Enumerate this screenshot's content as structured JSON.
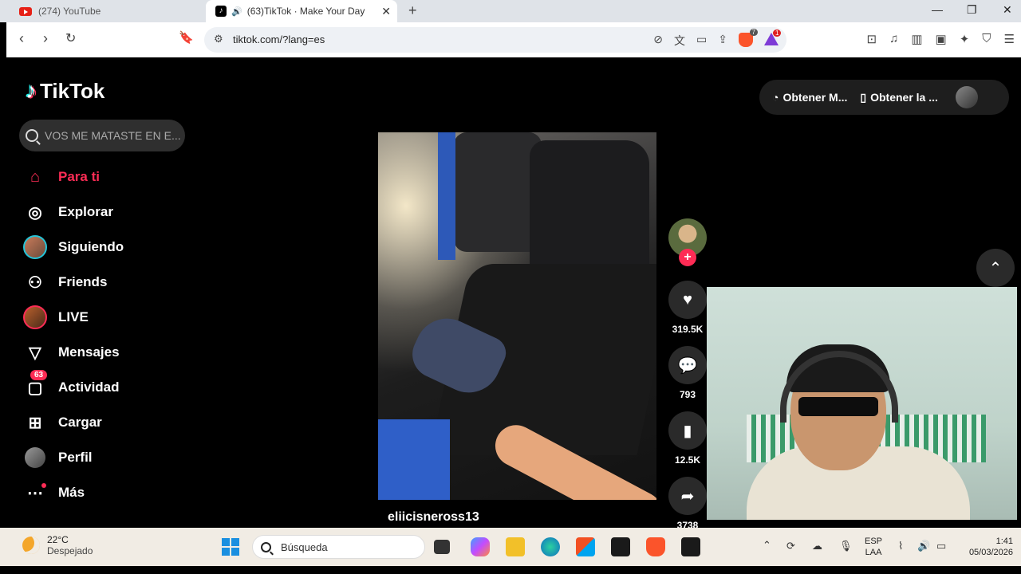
{
  "browser": {
    "tabs": [
      {
        "title": "(274) YouTube"
      },
      {
        "title": "(63)TikTok · Make Your Day"
      }
    ],
    "url": "tiktok.com/?lang=es"
  },
  "tiktok": {
    "logo": "TikTok",
    "search_placeholder": "VOS ME MATASTE EN E...",
    "nav": [
      {
        "label": "Para ti",
        "icon": "home-icon",
        "active": true
      },
      {
        "label": "Explorar",
        "icon": "compass-icon"
      },
      {
        "label": "Siguiendo",
        "icon": "following-avatar"
      },
      {
        "label": "Friends",
        "icon": "friends-icon"
      },
      {
        "label": "LIVE",
        "icon": "live-avatar"
      },
      {
        "label": "Mensajes",
        "icon": "send-icon"
      },
      {
        "label": "Actividad",
        "icon": "inbox-icon",
        "badge": "63"
      },
      {
        "label": "Cargar",
        "icon": "upload-icon"
      },
      {
        "label": "Perfil",
        "icon": "profile-avatar"
      },
      {
        "label": "Más",
        "icon": "more-icon"
      }
    ],
    "top_pill": {
      "get_coins": "Obtener M...",
      "get_app": "Obtener la ..."
    },
    "video": {
      "username": "eliicisneross13",
      "likes": "319.5K",
      "comments": "793",
      "saves": "12.5K",
      "shares": "3738"
    }
  },
  "taskbar": {
    "temperature": "22°C",
    "weather": "Despejado",
    "search": "Búsqueda",
    "lang_line1": "ESP",
    "lang_line2": "LAA",
    "time": "1:41",
    "date": "05/03/2026"
  },
  "colors": {
    "accent": "#fe2c55",
    "tiktok_cyan": "#25f4ee"
  }
}
